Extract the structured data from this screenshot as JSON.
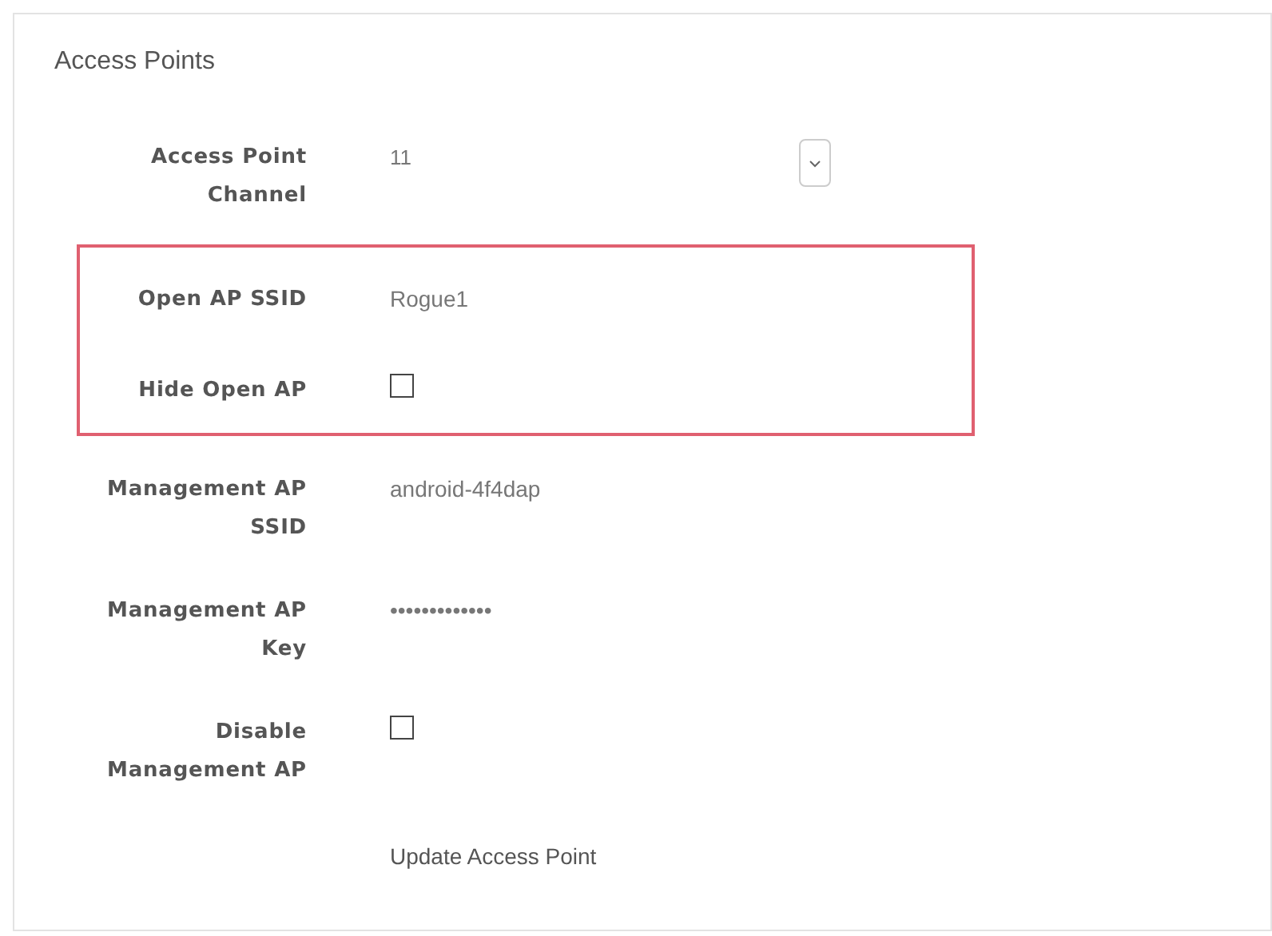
{
  "panel": {
    "title": "Access Points"
  },
  "fields": [
    {
      "kind": "select",
      "label": "Access Point Channel",
      "value": "11",
      "highlighted": false
    },
    {
      "kind": "text",
      "label": "Open AP SSID",
      "value": "Rogue1",
      "highlighted": true
    },
    {
      "kind": "checkbox",
      "label": "Hide Open AP",
      "checked": false,
      "highlighted": true
    },
    {
      "kind": "text",
      "label": "Management AP SSID",
      "value": "android-4f4dap",
      "highlighted": false
    },
    {
      "kind": "password",
      "label": "Management AP Key",
      "value": "•••••••••••••",
      "highlighted": false
    },
    {
      "kind": "checkbox",
      "label": "Disable Management AP",
      "checked": false,
      "highlighted": false
    }
  ],
  "submit": {
    "label": "Update Access Point"
  }
}
